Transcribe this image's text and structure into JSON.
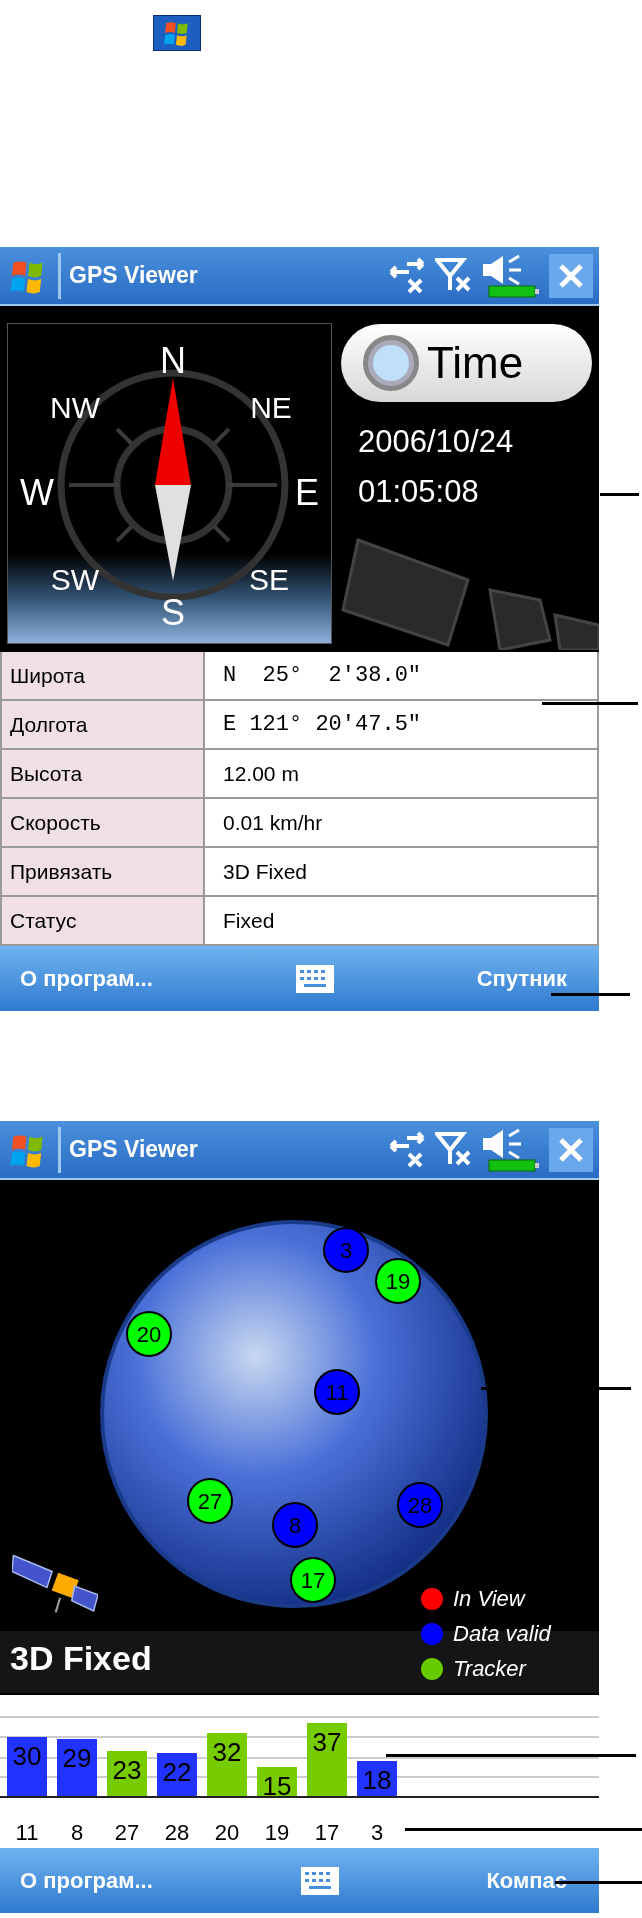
{
  "compass_screen": {
    "title": "GPS Viewer",
    "compass_labels": [
      "N",
      "NE",
      "E",
      "SE",
      "S",
      "SW",
      "W",
      "NW"
    ],
    "time_button": "Time",
    "date": "2006/10/24",
    "time": "01:05:08",
    "table": [
      {
        "label": "Широта",
        "value": "N  25°  2'38.0\"",
        "kind": "coordinate"
      },
      {
        "label": "Долгота",
        "value": "E 121° 20'47.5\"",
        "kind": "coordinate"
      },
      {
        "label": "Высота",
        "value": "12.00 m",
        "kind": "text"
      },
      {
        "label": "Скорость",
        "value": "0.01 km/hr",
        "kind": "text"
      },
      {
        "label": "Привязать",
        "value": "3D Fixed",
        "kind": "text"
      },
      {
        "label": "Статус",
        "value": "Fixed",
        "kind": "text"
      }
    ],
    "softkeys": {
      "left": "О програм...",
      "right": "Спутник"
    }
  },
  "satellite_screen": {
    "title": "GPS Viewer",
    "satellites": [
      {
        "label": "3",
        "color": "#0000ff"
      },
      {
        "label": "19",
        "color": "#00ff00"
      },
      {
        "label": "20",
        "color": "#00ff00"
      },
      {
        "label": "11",
        "color": "#0000ff"
      },
      {
        "label": "27",
        "color": "#00ff00"
      },
      {
        "label": "8",
        "color": "#0000ff"
      },
      {
        "label": "28",
        "color": "#0000ff"
      },
      {
        "label": "17",
        "color": "#00ff00"
      }
    ],
    "fix_status": "3D Fixed",
    "legend": [
      {
        "label": "In View",
        "color": "#ff0000"
      },
      {
        "label": "Data valid",
        "color": "#0000ff"
      },
      {
        "label": "Tracker",
        "color": "#66cc00"
      }
    ],
    "chart_data": {
      "type": "bar",
      "categories": [
        "11",
        "8",
        "27",
        "28",
        "20",
        "19",
        "17",
        "3"
      ],
      "ylim": [
        0,
        40
      ],
      "data_labels": true,
      "series": [
        {
          "color": "#2233ff",
          "values": [
            30,
            29,
            null,
            22,
            null,
            null,
            null,
            18
          ]
        },
        {
          "color": "#77cc00",
          "values": [
            null,
            null,
            23,
            null,
            32,
            15,
            37,
            null
          ]
        }
      ]
    },
    "softkeys": {
      "left": "О програм...",
      "right": "Компас"
    }
  }
}
